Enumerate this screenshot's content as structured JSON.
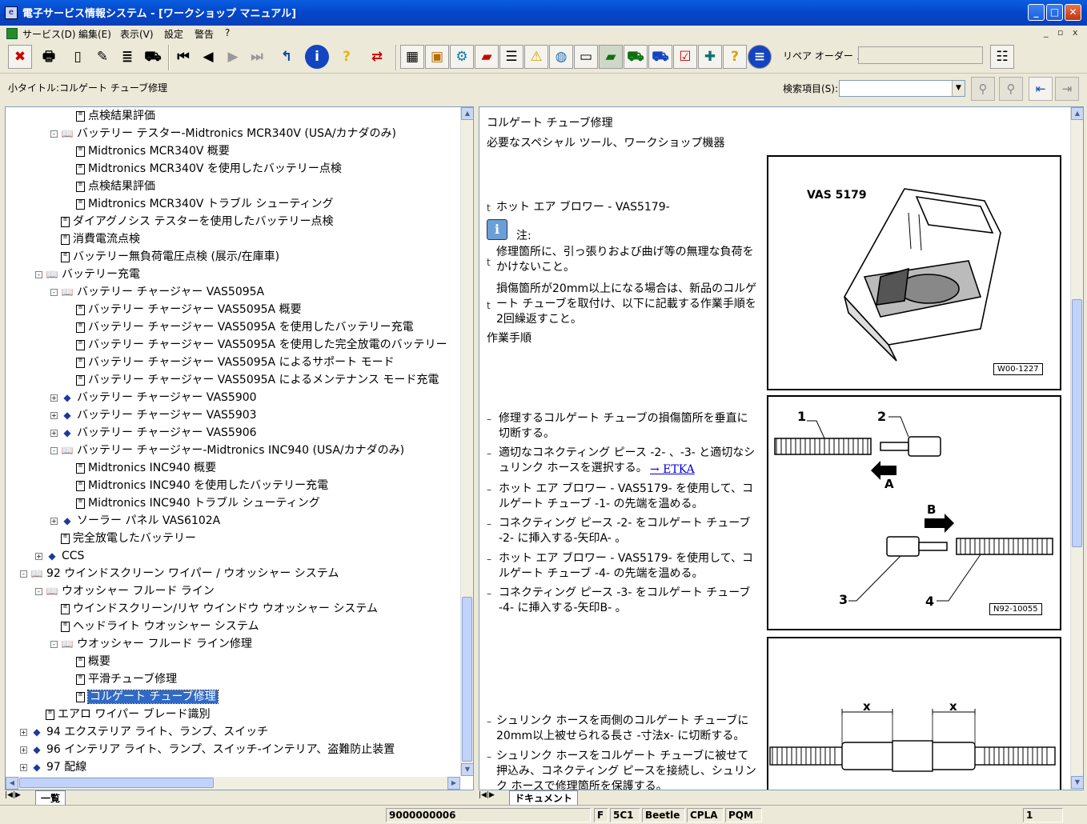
{
  "window": {
    "title": "電子サービス情報システム - [ワークショップ マニュアル]",
    "icon": "app-icon"
  },
  "menu": {
    "items": [
      "サービス(D)",
      "編集(E)",
      "表示(V)",
      "設定",
      "警告",
      "?"
    ],
    "mdi_controls": [
      "_",
      "▫",
      "x"
    ]
  },
  "toolbar": {
    "icons": [
      "exit-icon",
      "print-icon",
      "new-doc-icon",
      "doc-edit-icon",
      "doc-list-icon",
      "car-icon",
      "first-page-icon",
      "prev-page-icon",
      "next-page-icon",
      "last-page-icon",
      "back-icon",
      "info-icon",
      "help-icon",
      "switch-icon",
      "cube-icon",
      "box-icon",
      "gear-icon",
      "book-icon",
      "list-icon",
      "warning-icon",
      "globe-icon",
      "monitor-icon",
      "green-book-icon",
      "car-wrench-icon",
      "vehicle-icon",
      "checklist-icon",
      "book-tool-icon",
      "question-icon",
      "grid-icon",
      "memo-icon"
    ],
    "memo_label": "リペア オーダー メモ:",
    "memo_value": ""
  },
  "subtitle": "小タイトル:コルゲート チューブ修理",
  "search": {
    "label": "検索項目(S):",
    "value": ""
  },
  "tree": {
    "rows": [
      {
        "indent": 4,
        "kind": "doc",
        "exp": "",
        "text": "点検結果評価"
      },
      {
        "indent": 3,
        "kind": "open",
        "exp": "-",
        "text": "バッテリー テスター-Midtronics MCR340V (USA/カナダのみ)"
      },
      {
        "indent": 4,
        "kind": "doc",
        "exp": "",
        "text": "Midtronics MCR340V 概要"
      },
      {
        "indent": 4,
        "kind": "doc",
        "exp": "",
        "text": "Midtronics MCR340V  を使用したバッテリー点検"
      },
      {
        "indent": 4,
        "kind": "doc",
        "exp": "",
        "text": "点検結果評価"
      },
      {
        "indent": 4,
        "kind": "doc",
        "exp": "",
        "text": "Midtronics MCR340V  トラブル シューティング"
      },
      {
        "indent": 3,
        "kind": "doc",
        "exp": "",
        "text": "ダイアグノシス テスターを使用したバッテリー点検"
      },
      {
        "indent": 3,
        "kind": "doc",
        "exp": "",
        "text": "消費電流点検"
      },
      {
        "indent": 3,
        "kind": "doc",
        "exp": "",
        "text": "バッテリー無負荷電圧点検 (展示/在庫車)"
      },
      {
        "indent": 2,
        "kind": "open",
        "exp": "-",
        "text": "バッテリー充電"
      },
      {
        "indent": 3,
        "kind": "open",
        "exp": "-",
        "text": "バッテリー チャージャー VAS5095A"
      },
      {
        "indent": 4,
        "kind": "doc",
        "exp": "",
        "text": "バッテリー チャージャー VAS5095A  概要"
      },
      {
        "indent": 4,
        "kind": "doc",
        "exp": "",
        "text": "バッテリー チャージャー VAS5095A  を使用したバッテリー充電"
      },
      {
        "indent": 4,
        "kind": "doc",
        "exp": "",
        "text": "バッテリー チャージャー VAS5095A  を使用した完全放電のバッテリー"
      },
      {
        "indent": 4,
        "kind": "doc",
        "exp": "",
        "text": "バッテリー チャージャー VAS5095A  によるサポート モード"
      },
      {
        "indent": 4,
        "kind": "doc",
        "exp": "",
        "text": "バッテリー チャージャー VAS5095A  によるメンテナンス モード充電"
      },
      {
        "indent": 3,
        "kind": "closed",
        "exp": "+",
        "text": "バッテリー チャージャー VAS5900"
      },
      {
        "indent": 3,
        "kind": "closed",
        "exp": "+",
        "text": "バッテリー チャージャー VAS5903"
      },
      {
        "indent": 3,
        "kind": "closed",
        "exp": "+",
        "text": "バッテリー チャージャー VAS5906"
      },
      {
        "indent": 3,
        "kind": "open",
        "exp": "-",
        "text": "バッテリー チャージャー-Midtronics INC940  (USA/カナダのみ)"
      },
      {
        "indent": 4,
        "kind": "doc",
        "exp": "",
        "text": "Midtronics INC940  概要"
      },
      {
        "indent": 4,
        "kind": "doc",
        "exp": "",
        "text": "Midtronics INC940  を使用したバッテリー充電"
      },
      {
        "indent": 4,
        "kind": "doc",
        "exp": "",
        "text": "Midtronics INC940  トラブル シューティング"
      },
      {
        "indent": 3,
        "kind": "closed",
        "exp": "+",
        "text": "ソーラー パネル VAS6102A"
      },
      {
        "indent": 3,
        "kind": "doc",
        "exp": "",
        "text": "完全放電したバッテリー"
      },
      {
        "indent": 2,
        "kind": "closed",
        "exp": "+",
        "text": "CCS"
      },
      {
        "indent": 1,
        "kind": "open",
        "exp": "-",
        "text": "92 ウインドスクリーン ワイパー / ウオッシャー システム"
      },
      {
        "indent": 2,
        "kind": "open",
        "exp": "-",
        "text": "ウオッシャー フルード ライン"
      },
      {
        "indent": 3,
        "kind": "doc",
        "exp": "",
        "text": "ウインドスクリーン/リヤ ウインドウ ウオッシャー システム"
      },
      {
        "indent": 3,
        "kind": "doc",
        "exp": "",
        "text": "ヘッドライト ウオッシャー システム"
      },
      {
        "indent": 3,
        "kind": "open",
        "exp": "-",
        "text": "ウオッシャー フルード ライン修理"
      },
      {
        "indent": 4,
        "kind": "doc",
        "exp": "",
        "text": "概要"
      },
      {
        "indent": 4,
        "kind": "doc",
        "exp": "",
        "text": "平滑チューブ修理"
      },
      {
        "indent": 4,
        "kind": "doc",
        "exp": "",
        "text": "コルゲート チューブ修理",
        "selected": true
      },
      {
        "indent": 2,
        "kind": "doc",
        "exp": "",
        "text": "エアロ ワイパー ブレード識別"
      },
      {
        "indent": 1,
        "kind": "closed",
        "exp": "+",
        "text": "94 エクステリア ライト、ランプ、スイッチ"
      },
      {
        "indent": 1,
        "kind": "closed",
        "exp": "+",
        "text": "96 インテリア ライト、ランプ、スイッチ-インテリア、盗難防止装置"
      },
      {
        "indent": 1,
        "kind": "closed",
        "exp": "+",
        "text": "97 配線"
      }
    ]
  },
  "left_tab": "一覧",
  "doc": {
    "title": "コルゲート チューブ修理",
    "tools_heading": "必要なスペシャル ツール、ワークショップ機器",
    "tool_item": "ホット エア ブロワー - VAS5179-",
    "note_label": "注:",
    "note1": "修理箇所に、引っ張りおよび曲げ等の無理な負荷をかけないこと。",
    "note2": "損傷箇所が20mm以上になる場合は、新品のコルゲート チューブを取付け、以下に記載する作業手順を2回繰返すこと。",
    "procedure_heading": "作業手順",
    "steps": [
      "修理するコルゲート チューブの損傷箇所を垂直に切断する。",
      "適切なコネクティング ピース -2- 、-3- と適切なシュリンク ホースを選択する。",
      "ホット エア ブロワー - VAS5179- を使用して、コルゲート チューブ -1- の先端を温める。",
      "コネクティング ピース -2- をコルゲート チューブ -2- に挿入する-矢印A- 。",
      "ホット エア ブロワー - VAS5179- を使用して、コルゲート チューブ -4- の先端を温める。",
      "コネクティング ピース -3- をコルゲート チューブ -4- に挿入する-矢印B- 。"
    ],
    "etka_link": "→ ETKA",
    "steps2": [
      "シュリンク ホースを両側のコルゲート チューブに20mm以上被せられる長さ -寸法x- に切断する。",
      "シュリンク ホースをコルゲート チューブに被せて押込み、コネクティング ピースを接続し、シュリンク ホースで修理箇所を保護する。"
    ],
    "fig1": {
      "label": "VAS 5179",
      "ref": "W00-1227"
    },
    "fig2": {
      "labels": [
        "1",
        "2",
        "A",
        "B",
        "3",
        "4"
      ],
      "ref": "N92-10055"
    },
    "fig3": {
      "labels": [
        "x",
        "x"
      ]
    }
  },
  "right_tab": "ドキュメント",
  "status": {
    "fields": [
      "9000000006",
      "F",
      "5C1",
      "Beetle",
      "CPLA",
      "PQM",
      "1"
    ]
  }
}
